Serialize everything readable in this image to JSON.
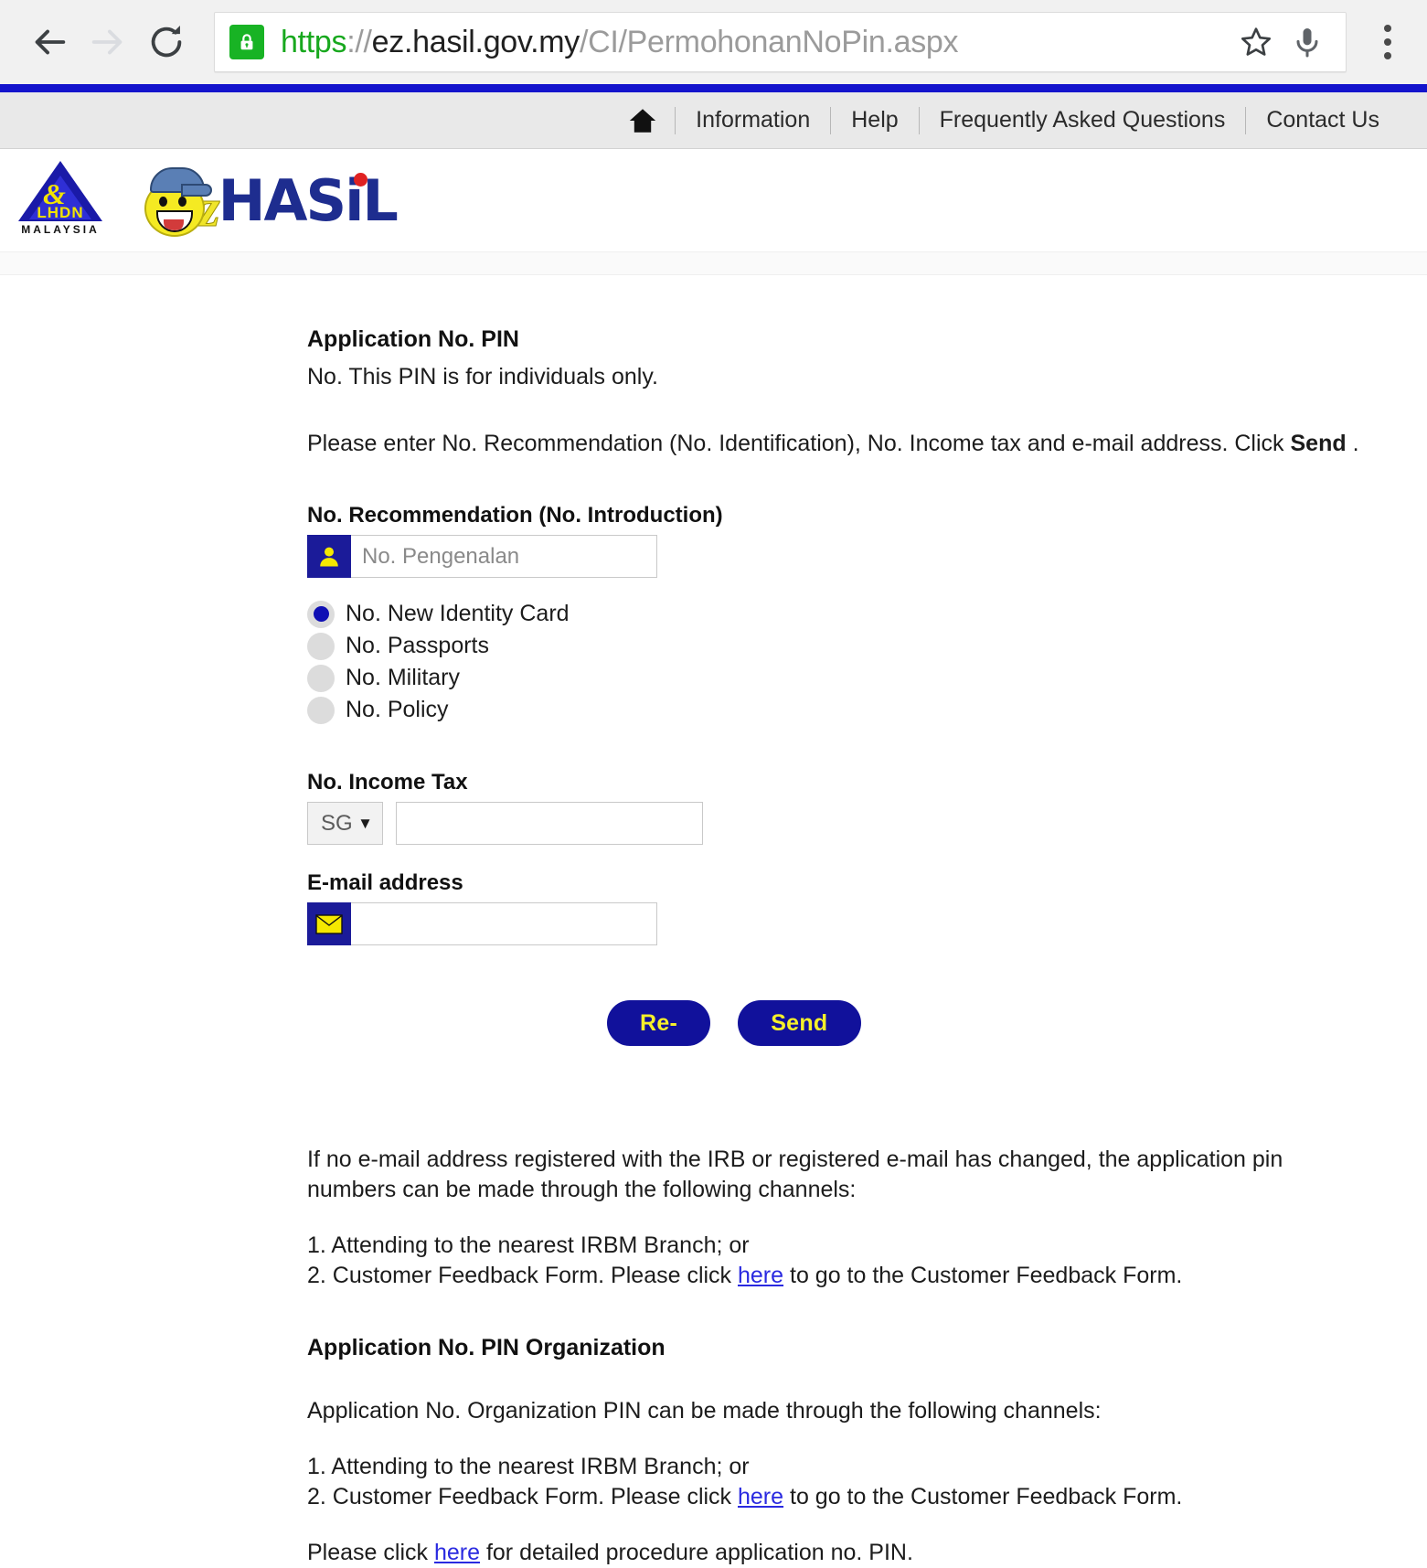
{
  "browser": {
    "back_icon": "back-arrow-icon",
    "forward_icon": "forward-arrow-icon",
    "reload_icon": "reload-icon",
    "lock_icon": "lock-icon",
    "url": {
      "scheme": "https",
      "separator": "://",
      "host": "ez.hasil.gov.my",
      "path": "/CI/PermohonanNoPin.aspx",
      "full": "https://ez.hasil.gov.my/CI/PermohonanNoPin.aspx"
    },
    "bookmark_icon": "star-icon",
    "voice_icon": "microphone-icon",
    "menu_icon": "three-dot-menu-icon"
  },
  "topnav": {
    "home_icon": "home-icon",
    "links": [
      {
        "label": "Information"
      },
      {
        "label": "Help"
      },
      {
        "label": "Frequently Asked Questions"
      },
      {
        "label": "Contact Us"
      }
    ]
  },
  "logo": {
    "lhdn_word": "LHDN",
    "lhdn_sub": "MALAYSIA",
    "ez_letter": "z",
    "hasil_word": "HASiL"
  },
  "main": {
    "heading": "Application No. PIN",
    "subheading": "No. This PIN is for individuals only.",
    "instruction_pre": "Please enter No. Recommendation (No. Identification), No. Income tax and e-mail address. Click ",
    "instruction_bold": "Send",
    "instruction_post": " .",
    "recommendation": {
      "label": "No. Recommendation (No. Introduction)",
      "icon": "person-icon",
      "placeholder": "No. Pengenalan",
      "value": ""
    },
    "id_types": [
      {
        "label": "No. New Identity Card",
        "selected": true
      },
      {
        "label": "No. Passports",
        "selected": false
      },
      {
        "label": "No. Military",
        "selected": false
      },
      {
        "label": "No. Policy",
        "selected": false
      }
    ],
    "income_tax": {
      "label": "No. Income Tax",
      "prefix_selected": "SG",
      "prefix_caret": "▼",
      "value": "",
      "placeholder": ""
    },
    "email": {
      "label": "E-mail address",
      "icon": "envelope-icon",
      "value": "",
      "placeholder": ""
    },
    "buttons": {
      "reset_label": "Re-",
      "send_label": "Send"
    }
  },
  "notes": {
    "individual_intro_l1": "If no e-mail address registered with the IRB or registered e-mail has changed, the application pin",
    "individual_intro_l2": "numbers can be made through the following channels:",
    "channel_1": "1. Attending to the nearest IRBM Branch; or",
    "channel_2_pre": "2. Customer Feedback Form. Please click ",
    "channel_2_link": "here",
    "channel_2_post": " to go to the Customer Feedback Form.",
    "org_heading": "Application No. PIN Organization",
    "org_intro": "Application No. Organization PIN can be made through the following channels:",
    "org_channel_1": "1. Attending to the nearest IRBM Branch; or",
    "org_channel_2_pre": "2. Customer Feedback Form. Please click ",
    "org_channel_2_link": "here",
    "org_channel_2_post": " to go to the Customer Feedback Form.",
    "procedure_pre": "Please click ",
    "procedure_link": "here",
    "procedure_post": " for detailed procedure application no. PIN."
  },
  "colors": {
    "brand_blue": "#1414cc",
    "icon_box_blue": "#1b1b99",
    "accent_yellow": "#f5f02a",
    "link_blue": "#2a2ae0",
    "secure_green": "#18b324"
  }
}
